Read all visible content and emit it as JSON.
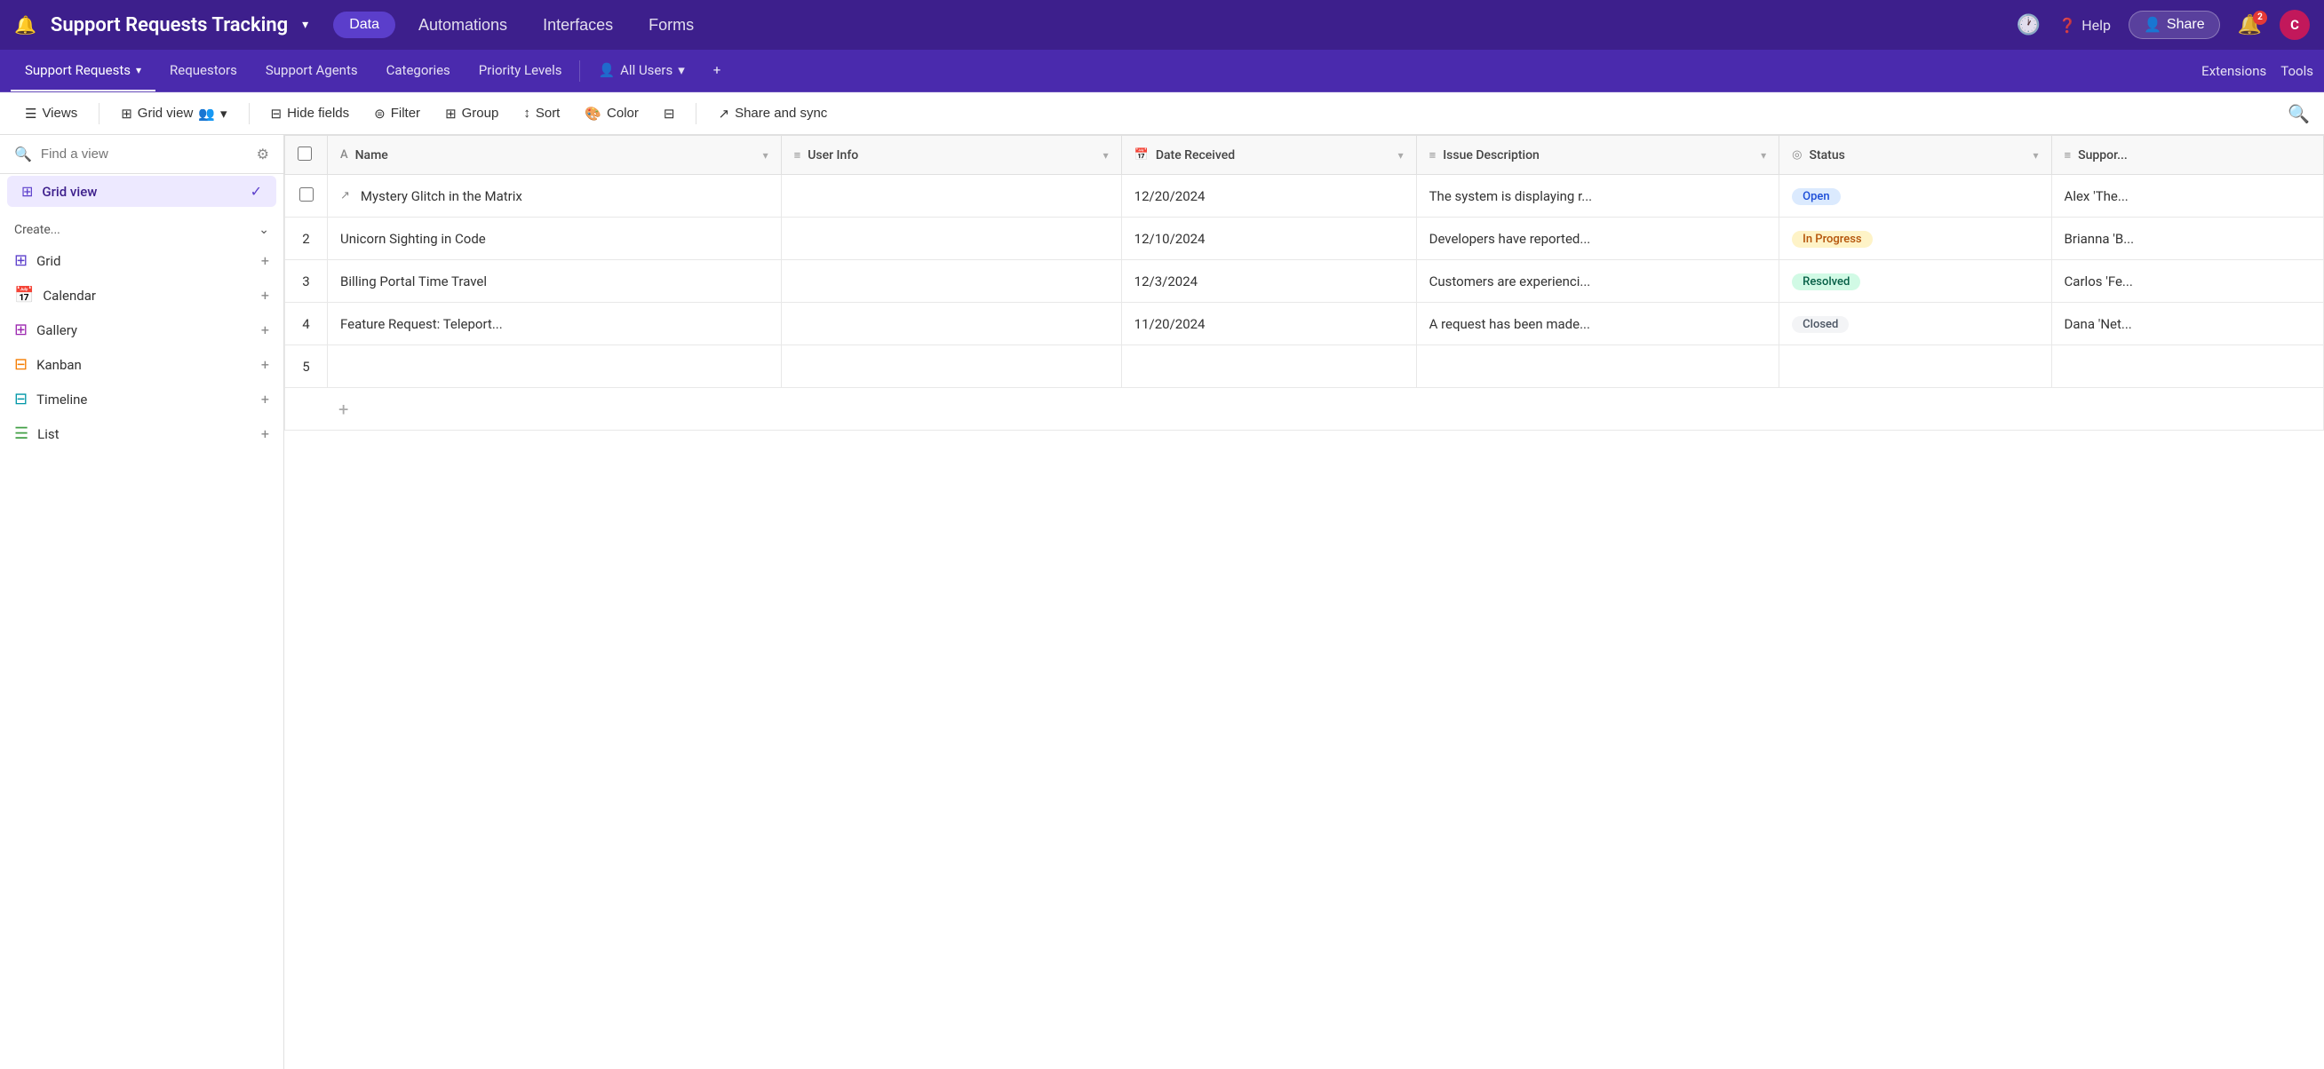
{
  "app": {
    "title": "Support Requests Tracking",
    "logo": "🔔"
  },
  "topnav": {
    "title": "Support Requests Tracking",
    "chevron": "▾",
    "data_btn": "Data",
    "automations_btn": "Automations",
    "interfaces_btn": "Interfaces",
    "forms_btn": "Forms",
    "history_icon": "🕐",
    "help_label": "Help",
    "share_label": "Share",
    "notif_count": "2",
    "avatar_letter": "C"
  },
  "tabbar": {
    "tabs": [
      {
        "label": "Support Requests",
        "active": true,
        "dropdown": true
      },
      {
        "label": "Requestors",
        "active": false
      },
      {
        "label": "Support Agents",
        "active": false
      },
      {
        "label": "Categories",
        "active": false
      },
      {
        "label": "Priority Levels",
        "active": false
      },
      {
        "label": "All Users",
        "active": false,
        "icon": "👤"
      }
    ],
    "add_tab": "+",
    "extensions_label": "Extensions",
    "tools_label": "Tools"
  },
  "toolbar": {
    "views_label": "Views",
    "grid_view_label": "Grid view",
    "hide_fields_label": "Hide fields",
    "filter_label": "Filter",
    "group_label": "Group",
    "sort_label": "Sort",
    "color_label": "Color",
    "share_sync_label": "Share and sync"
  },
  "sidebar": {
    "search_placeholder": "Find a view",
    "views": [
      {
        "label": "Grid view",
        "icon": "grid",
        "active": true
      }
    ],
    "create_section_label": "Create...",
    "create_items": [
      {
        "label": "Grid",
        "icon": "grid"
      },
      {
        "label": "Calendar",
        "icon": "calendar"
      },
      {
        "label": "Gallery",
        "icon": "gallery"
      },
      {
        "label": "Kanban",
        "icon": "kanban"
      },
      {
        "label": "Timeline",
        "icon": "timeline"
      },
      {
        "label": "List",
        "icon": "list"
      }
    ]
  },
  "table": {
    "columns": [
      {
        "label": "Name",
        "icon": "A",
        "type": "text"
      },
      {
        "label": "User Info",
        "icon": "≡",
        "type": "text"
      },
      {
        "label": "Date Received",
        "icon": "📅",
        "type": "date"
      },
      {
        "label": "Issue Description",
        "icon": "≡",
        "type": "text"
      },
      {
        "label": "Status",
        "icon": "◎",
        "type": "status"
      },
      {
        "label": "Suppor...",
        "icon": "≡",
        "type": "text"
      }
    ],
    "rows": [
      {
        "num": "",
        "name": "Mystery Glitch in the Matrix",
        "user_info": "",
        "date": "12/20/2024",
        "description": "The system is displaying r...",
        "status": "Open",
        "status_type": "open",
        "support": "Alex 'The..."
      },
      {
        "num": "2",
        "name": "Unicorn Sighting in Code",
        "user_info": "",
        "date": "12/10/2024",
        "description": "Developers have reported...",
        "status": "In Progress",
        "status_type": "inprogress",
        "support": "Brianna 'B..."
      },
      {
        "num": "3",
        "name": "Billing Portal Time Travel",
        "user_info": "",
        "date": "12/3/2024",
        "description": "Customers are experienci...",
        "status": "Resolved",
        "status_type": "resolved",
        "support": "Carlos 'Fe..."
      },
      {
        "num": "4",
        "name": "Feature Request: Teleport...",
        "user_info": "",
        "date": "11/20/2024",
        "description": "A request has been made...",
        "status": "Closed",
        "status_type": "closed",
        "support": "Dana 'Net..."
      }
    ]
  }
}
